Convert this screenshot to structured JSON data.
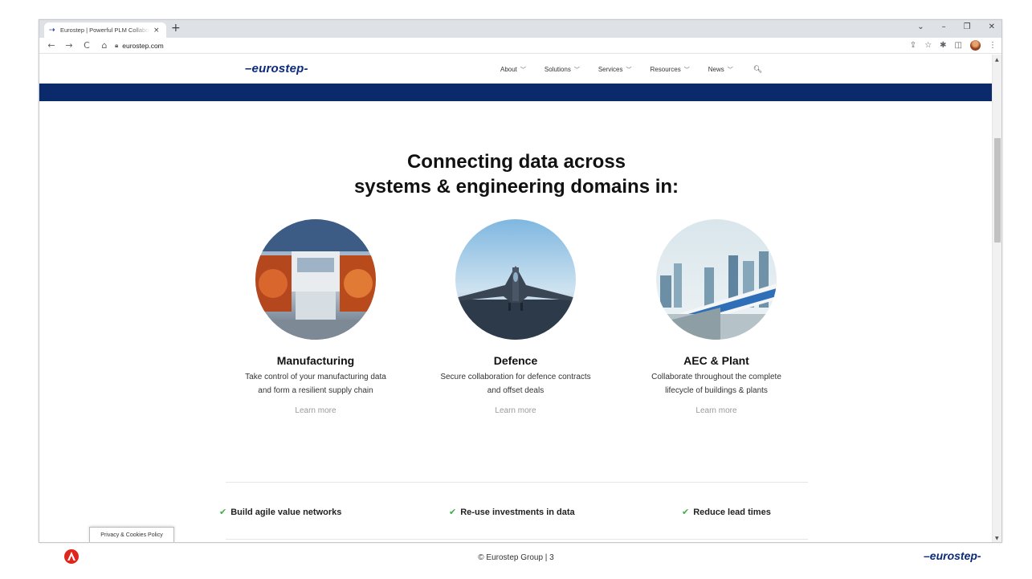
{
  "browser": {
    "tab_title": "Eurostep | Powerful PLM Collaboration",
    "tab_favicon": "eurostep-favicon",
    "tab_close": "×",
    "new_tab": "+",
    "window_controls": [
      "⌄",
      "–",
      "❐",
      "✕"
    ],
    "nav_back": "←",
    "nav_forward": "→",
    "nav_reload": "C",
    "nav_home": "⌂",
    "url": "eurostep.com",
    "toolbar_icons": [
      "share-icon",
      "star-icon",
      "extensions-icon",
      "sidepanel-icon",
      "profile-avatar",
      "menu-icon"
    ]
  },
  "site": {
    "logo": "→eurostep→",
    "logo_text": "eurostep",
    "nav": [
      {
        "label": "About"
      },
      {
        "label": "Solutions"
      },
      {
        "label": "Services"
      },
      {
        "label": "Resources"
      },
      {
        "label": "News"
      }
    ],
    "brand_color": "#0a2a6b"
  },
  "hero": {
    "line1": "Connecting data across",
    "line2": "systems & engineering domains in:"
  },
  "cards": [
    {
      "title": "Manufacturing",
      "desc1": "Take control of your manufacturing data",
      "desc2": "and form a resilient supply chain",
      "link": "Learn more",
      "image": "car-assembly-line"
    },
    {
      "title": "Defence",
      "desc1": "Secure collaboration for defence contracts",
      "desc2": "and offset deals",
      "link": "Learn more",
      "image": "fighter-jet"
    },
    {
      "title": "AEC & Plant",
      "desc1": "Collaborate throughout the complete",
      "desc2": "lifecycle of buildings & plants",
      "link": "Learn more",
      "image": "metro-train-city"
    }
  ],
  "benefits": [
    "Build agile value networks",
    "Re-use investments in data",
    "Reduce lead times"
  ],
  "check_color": "#3fae49",
  "cookie_label": "Privacy & Cookies Policy",
  "footer": {
    "text": "© Eurostep Group   |   3",
    "logo_right": "eurostep"
  }
}
